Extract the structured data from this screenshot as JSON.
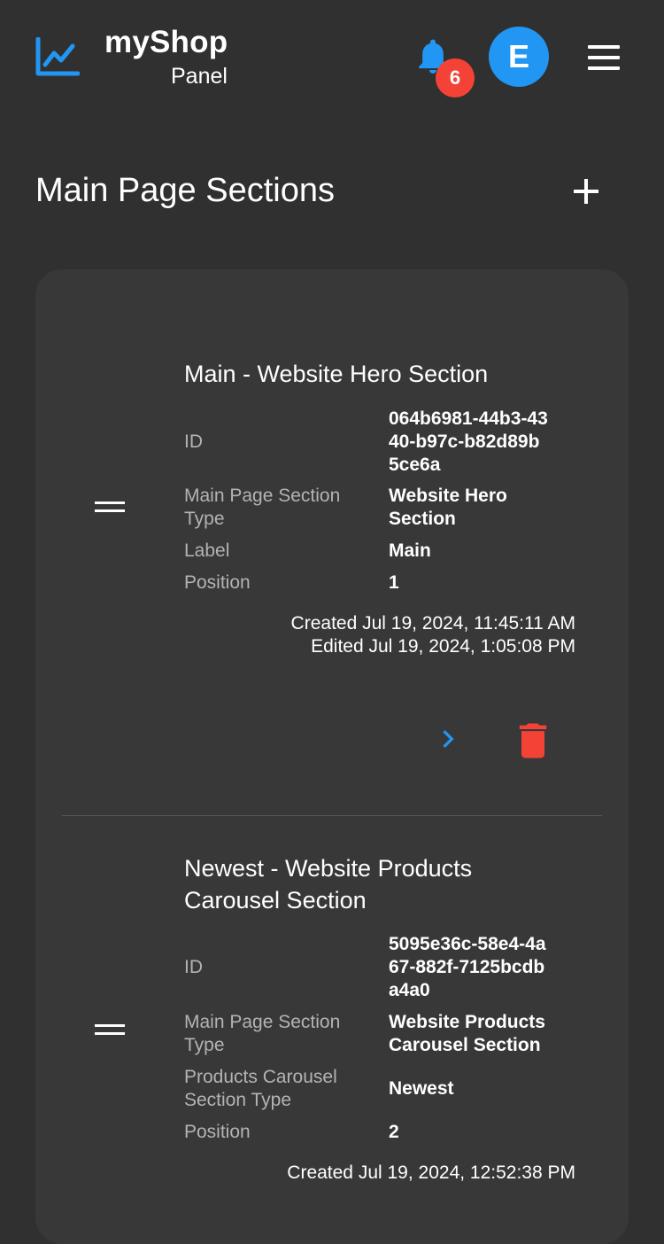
{
  "header": {
    "brand_title": "myShop",
    "brand_subtitle": "Panel",
    "notification_count": "6",
    "avatar_initial": "E"
  },
  "colors": {
    "accent": "#2196F3",
    "danger": "#F44336",
    "background": "#303030",
    "card": "#383838"
  },
  "page": {
    "title": "Main Page Sections"
  },
  "sections": [
    {
      "title": "Main - Website Hero Section",
      "fields": [
        {
          "key": "ID",
          "value": "064b6981-44b3-4340-b97c-b82d89b5ce6a"
        },
        {
          "key": "Main Page Section Type",
          "value": "Website Hero Section"
        },
        {
          "key": "Label",
          "value": "Main"
        },
        {
          "key": "Position",
          "value": "1"
        }
      ],
      "created": "Created Jul 19, 2024, 11:45:11 AM",
      "edited": "Edited Jul 19, 2024, 1:05:08 PM"
    },
    {
      "title": "Newest - Website Products Carousel Section",
      "fields": [
        {
          "key": "ID",
          "value": "5095e36c-58e4-4a67-882f-7125bcdba4a0"
        },
        {
          "key": "Main Page Section Type",
          "value": "Website Products Carousel Section"
        },
        {
          "key": "Products Carousel Section Type",
          "value": "Newest"
        },
        {
          "key": "Position",
          "value": "2"
        }
      ],
      "created": "Created Jul 19, 2024, 12:52:38 PM"
    }
  ],
  "icons": {
    "logo": "chart-line-icon",
    "bell": "bell-icon",
    "menu": "hamburger-menu-icon",
    "add": "plus-icon",
    "drag": "drag-handle-icon",
    "open": "chevron-right-icon",
    "delete": "trash-icon"
  }
}
